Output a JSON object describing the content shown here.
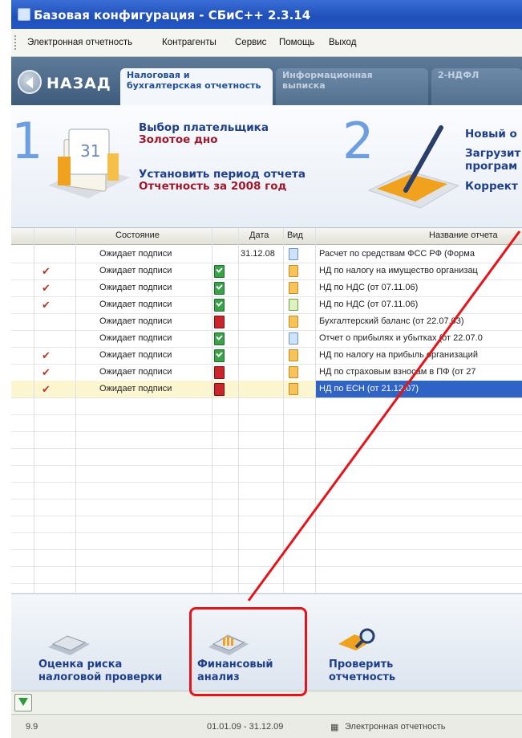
{
  "window": {
    "title": "Базовая конфигурация - СБиС++ 2.3.14"
  },
  "menu": [
    "Электронная отчетность",
    "Контрагенты",
    "Сервис",
    "Помощь",
    "Выход"
  ],
  "nav": {
    "back_label": "НАЗАД",
    "tabs": [
      "Налоговая и\nбухгалтерская отчетность",
      "Информационная\nвыписка",
      "2-НДФЛ"
    ]
  },
  "wizard": {
    "step1": {
      "number": "1",
      "line1": "Выбор плательщика",
      "line2": "Золотое дно",
      "line3": "Установить период отчета",
      "line4": "Отчетность за 2008 год"
    },
    "step2": {
      "number": "2",
      "line1": "Новый о",
      "line2": "Загрузит",
      "line3": "програм",
      "line4": "Коррект"
    }
  },
  "table": {
    "headers": {
      "state": "Состояние",
      "date": "Дата",
      "kind": "Вид",
      "name": "Название отчета"
    },
    "rows": [
      {
        "checked": false,
        "state": "Ожидает подписи",
        "status": "none",
        "date": "31.12.08",
        "doc": "blue",
        "name": "Расчет по средствам ФСС РФ (Форма",
        "selected": false
      },
      {
        "checked": true,
        "state": "Ожидает подписи",
        "status": "green",
        "date": "",
        "doc": "orange",
        "name": "НД по налогу на имущество организац",
        "selected": false
      },
      {
        "checked": true,
        "state": "Ожидает подписи",
        "status": "green",
        "date": "",
        "doc": "orange",
        "name": "НД по НДС (от 07.11.06)",
        "selected": false
      },
      {
        "checked": true,
        "state": "Ожидает подписи",
        "status": "green",
        "date": "",
        "doc": "edit",
        "name": "НД по НДС (от 07.11.06)",
        "selected": false
      },
      {
        "checked": false,
        "state": "Ожидает подписи",
        "status": "red",
        "date": "",
        "doc": "orange",
        "name": "Бухгалтерский баланс (от 22.07.03)",
        "selected": false
      },
      {
        "checked": false,
        "state": "Ожидает подписи",
        "status": "green",
        "date": "",
        "doc": "blue",
        "name": "Отчет о прибылях и убытках (от 22.07.0",
        "selected": false
      },
      {
        "checked": true,
        "state": "Ожидает подписи",
        "status": "green",
        "date": "",
        "doc": "orange",
        "name": "НД по налогу на прибыль организаций",
        "selected": false
      },
      {
        "checked": true,
        "state": "Ожидает подписи",
        "status": "red",
        "date": "",
        "doc": "orange",
        "name": "НД по страховым взносам в ПФ (от 27",
        "selected": false
      },
      {
        "checked": true,
        "state": "Ожидает подписи",
        "status": "red",
        "date": "",
        "doc": "orange",
        "name": "НД по ЕСН (от 21.12.07)",
        "selected": true
      }
    ]
  },
  "toolbar": {
    "risk": "Оценка риска\nналоговой проверки",
    "finance": "Финансовый\nанализ",
    "check": "Проверить\nотчетность"
  },
  "statusbar": {
    "left": "9.9",
    "period": "01.01.09 - 31.12.09",
    "mode": "Электронная отчетность"
  },
  "colors": {
    "accent": "#2f63c4",
    "annotation": "#e5141a",
    "selected_row": "#fbf6cf"
  }
}
